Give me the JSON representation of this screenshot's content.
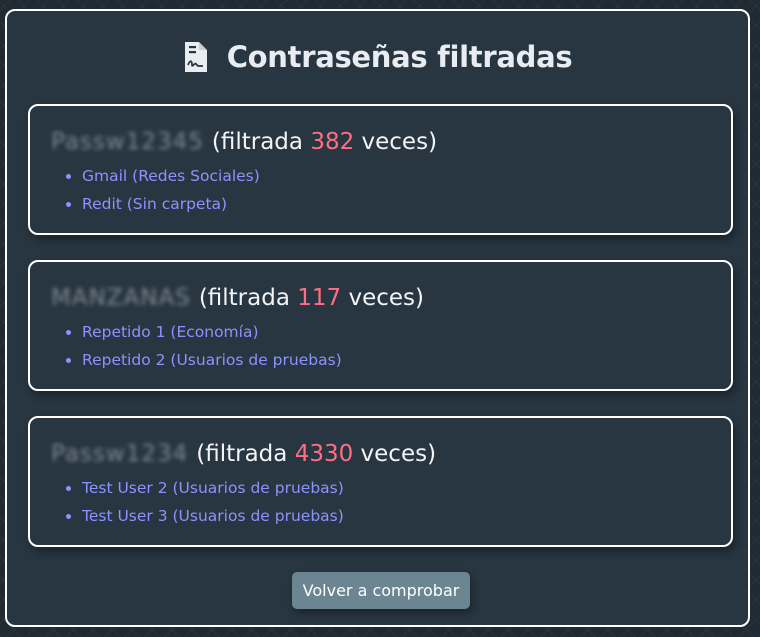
{
  "header": {
    "title": "Contraseñas filtradas",
    "icon": "file-signature-icon"
  },
  "colors": {
    "panel_bg": "#283641",
    "border": "#ffffff",
    "count": "#ff6e82",
    "link": "#8c92ff",
    "button_bg": "#6b8592"
  },
  "leaks": [
    {
      "password_masked": "Passw12345",
      "prefix": "(filtrada ",
      "count": "382",
      "suffix": " veces)",
      "sites": [
        "Gmail (Redes Sociales)",
        "Redit (Sin carpeta)"
      ]
    },
    {
      "password_masked": "MANZANAS",
      "prefix": "(filtrada ",
      "count": "117",
      "suffix": " veces)",
      "sites": [
        "Repetido 1 (Economía)",
        "Repetido 2 (Usuarios de pruebas)"
      ]
    },
    {
      "password_masked": "Passw1234",
      "prefix": "(filtrada ",
      "count": "4330",
      "suffix": " veces)",
      "sites": [
        "Test User 2 (Usuarios de pruebas)",
        "Test User 3 (Usuarios de pruebas)"
      ]
    }
  ],
  "actions": {
    "recheck_label": "Volver a comprobar"
  }
}
